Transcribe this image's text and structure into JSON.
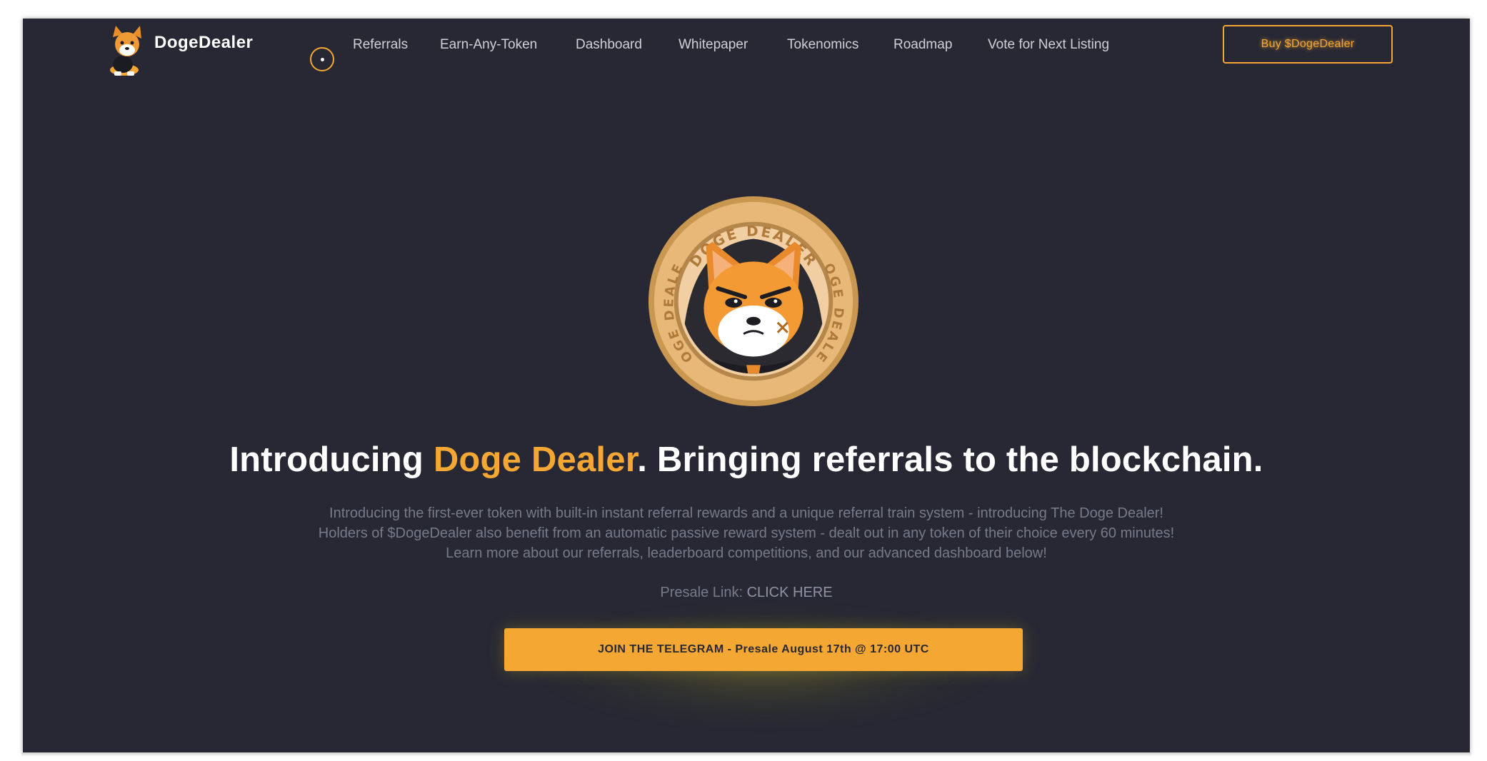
{
  "header": {
    "brand": "DogeDealer",
    "nav": [
      "Referrals",
      "Earn-Any-Token",
      "Dashboard",
      "Whitepaper",
      "Tokenomics",
      "Roadmap",
      "Vote for Next Listing"
    ],
    "buy_label": "Buy $DogeDealer"
  },
  "coin": {
    "ring_text_top": "DOGE DEALER",
    "ring_text_left": "DOGE DEALER",
    "ring_text_right": "DOGE DEALER"
  },
  "hero": {
    "headline_pre": "Introducing ",
    "headline_accent": "Doge Dealer",
    "headline_post": ". Bringing referrals to the blockchain.",
    "desc_line1": "Introducing the first-ever token with built-in instant referral rewards and a unique referral train system - introducing The Doge Dealer!",
    "desc_line2": "Holders of $DogeDealer also benefit from an automatic passive reward system - dealt out in any token of their choice every 60 minutes!",
    "desc_line3": "Learn more about our referrals, leaderboard competitions, and our advanced dashboard below!",
    "presale_label": "Presale Link: ",
    "presale_link": "CLICK HERE",
    "cta_label": "JOIN THE TELEGRAM - Presale August 17th @ 17:00 UTC"
  },
  "colors": {
    "background": "#272834",
    "accent": "#f4a733",
    "muted_text": "#777a88"
  },
  "icons": [
    "doge-logo-icon",
    "nav-toggle-icon",
    "doge-coin-icon"
  ]
}
